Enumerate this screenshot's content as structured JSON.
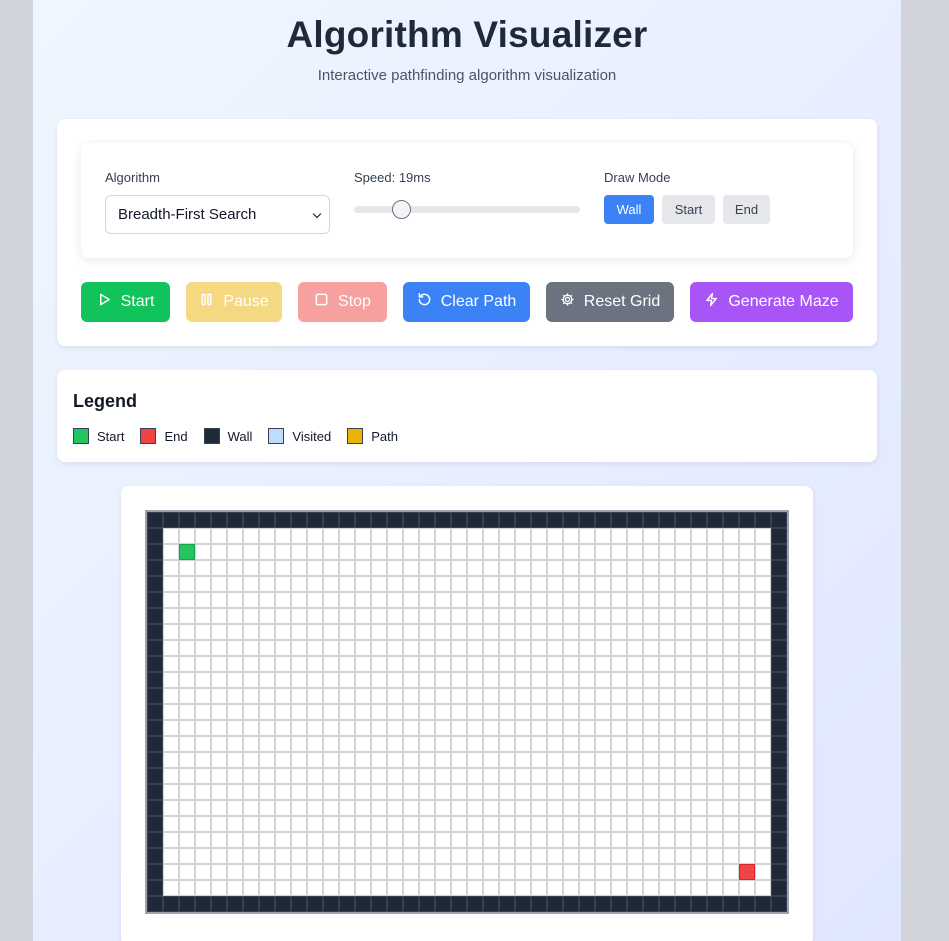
{
  "header": {
    "title": "Algorithm Visualizer",
    "subtitle": "Interactive pathfinding algorithm visualization"
  },
  "controls": {
    "algorithm_label": "Algorithm",
    "algorithm_value": "Breadth-First Search",
    "speed_label": "Speed: 19ms",
    "speed_fraction": 0.21,
    "draw_mode_label": "Draw Mode",
    "draw_modes": [
      {
        "label": "Wall",
        "active": true
      },
      {
        "label": "Start",
        "active": false
      },
      {
        "label": "End",
        "active": false
      }
    ]
  },
  "actions": [
    {
      "label": "Start",
      "icon": "play-icon",
      "color": "#10c35a",
      "opacity": 1
    },
    {
      "label": "Pause",
      "icon": "pause-icon",
      "color": "#eab308",
      "opacity": 0.5
    },
    {
      "label": "Stop",
      "icon": "square-icon",
      "color": "#ef4444",
      "opacity": 0.5
    },
    {
      "label": "Clear Path",
      "icon": "rotate-ccw-icon",
      "color": "#3b82f6",
      "opacity": 1
    },
    {
      "label": "Reset Grid",
      "icon": "gear-icon",
      "color": "#6b7280",
      "opacity": 1
    },
    {
      "label": "Generate Maze",
      "icon": "zap-icon",
      "color": "#a855f7",
      "opacity": 1
    }
  ],
  "legend": {
    "title": "Legend",
    "items": [
      {
        "label": "Start",
        "color": "#22c55e"
      },
      {
        "label": "End",
        "color": "#ef4444"
      },
      {
        "label": "Wall",
        "color": "#1f2937"
      },
      {
        "label": "Visited",
        "color": "#bfdbfe"
      },
      {
        "label": "Path",
        "color": "#eab308"
      }
    ]
  },
  "grid": {
    "rows": 25,
    "cols": 40,
    "start": [
      2,
      2
    ],
    "end": [
      22,
      37
    ],
    "border_walls": true
  }
}
